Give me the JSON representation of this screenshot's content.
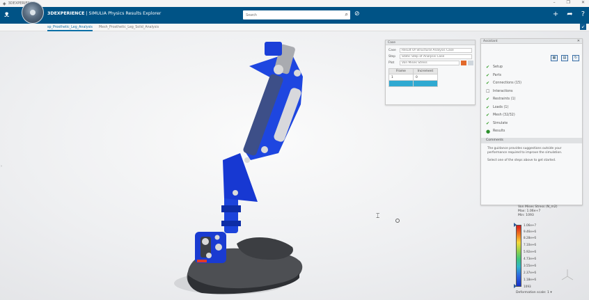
{
  "window": {
    "title": "3DEXPERIENCE",
    "controls": [
      "–",
      "❐",
      "✕"
    ]
  },
  "topbar": {
    "brand_prefix": "3DEXPERIENCE",
    "app_name": "| SIMULIA Physics Results Explorer",
    "search_placeholder": "Search",
    "icons": [
      "compass-icon",
      "search-icon",
      "tag-icon",
      "plus-icon",
      "share-icon",
      "help-icon"
    ]
  },
  "tabs": [
    {
      "label": "sp_Prosthetic_Leg_Analysis",
      "active": true
    },
    {
      "label": "Mesh_Prosthetic_Leg_Solid_Analysis",
      "active": false
    }
  ],
  "case_panel": {
    "title": "Case",
    "rows": [
      {
        "label": "Case",
        "value": "Result Of Structural Analysis Case"
      },
      {
        "label": "Step",
        "value": "Static Step of Analysis Case"
      },
      {
        "label": "Plot",
        "value": "Von Mises Stress"
      }
    ],
    "table": {
      "headers": [
        "Frame",
        "Increment"
      ],
      "rows": [
        {
          "frame": "1",
          "increment": "0",
          "selected": false
        },
        {
          "frame": "",
          "increment": "",
          "selected": true
        }
      ]
    }
  },
  "guide_panel": {
    "title": "Assistant",
    "steps": [
      {
        "label": "Setup",
        "status": "check"
      },
      {
        "label": "Parts",
        "status": "check"
      },
      {
        "label": "Connections (15)",
        "status": "check"
      },
      {
        "label": "Interactions",
        "status": "box"
      },
      {
        "label": "Restraints (1)",
        "status": "check"
      },
      {
        "label": "Loads (1)",
        "status": "check"
      },
      {
        "label": "Mesh (32/32)",
        "status": "check"
      },
      {
        "label": "Simulate",
        "status": "check"
      },
      {
        "label": "Results",
        "status": "dot"
      }
    ],
    "message_header": "Comments",
    "messages": [
      "The guidance provides suggestions outside your performance required to improve the simulation.",
      "Select one of the steps above to get started."
    ]
  },
  "legend": {
    "quantity": "Von Mises Stress (N_m2)",
    "max_line": "Max: 1.06e+7",
    "min_line": "Min: 1093",
    "values": [
      "1.06e+7",
      "9.46e+6",
      "8.28e+6",
      "7.10e+6",
      "5.92e+6",
      "4.73e+6",
      "3.55e+6",
      "2.37e+6",
      "1.18e+6",
      "1093"
    ],
    "deformation_label": "Deformation scale: 1"
  },
  "colors": {
    "topbar": "#005386",
    "accent": "#0b6fa6",
    "model_blue": "#1632c8",
    "selected_row": "#2fa9d1",
    "check_green": "#37a02c"
  }
}
